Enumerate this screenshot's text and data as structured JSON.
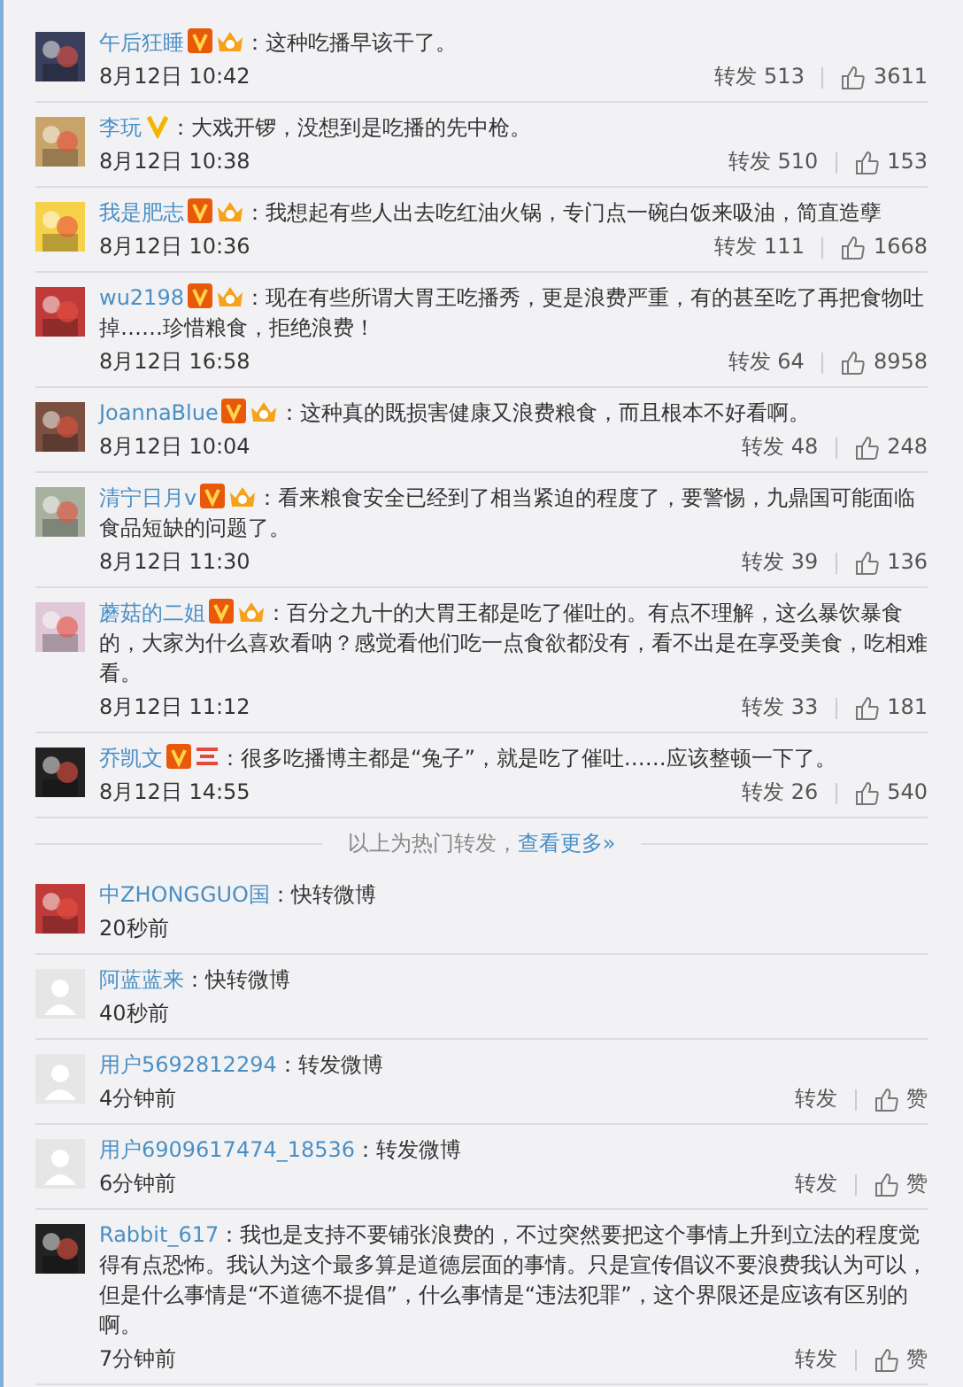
{
  "hot_reposts": [
    {
      "default_avatar": false,
      "name": "午后狂睡",
      "badges": [
        {
          "kind": "verified"
        },
        {
          "kind": "member"
        }
      ],
      "text": "：这种吃播早该干了。",
      "time": "8月12日 10:42",
      "repost": "转发 513",
      "like": "3611"
    },
    {
      "default_avatar": false,
      "name": "李玩",
      "badges": [
        {
          "kind": "personal"
        }
      ],
      "text": "：大戏开锣，没想到是吃播的先中枪。",
      "time": "8月12日 10:38",
      "repost": "转发 510",
      "like": "153"
    },
    {
      "default_avatar": false,
      "name": "我是肥志",
      "badges": [
        {
          "kind": "verified"
        },
        {
          "kind": "member"
        }
      ],
      "text": "：我想起有些人出去吃红油火锅，专门点一碗白饭来吸油，简直造孽",
      "time": "8月12日 10:36",
      "repost": "转发 111",
      "like": "1668"
    },
    {
      "default_avatar": false,
      "name": "wu2198",
      "badges": [
        {
          "kind": "verified"
        },
        {
          "kind": "member"
        }
      ],
      "text": "：现在有些所谓大胃王吃播秀，更是浪费严重，有的甚至吃了再把食物吐掉……珍惜粮食，拒绝浪费！",
      "time": "8月12日 16:58",
      "repost": "转发 64",
      "like": "8958"
    },
    {
      "default_avatar": false,
      "name": "JoannaBlue",
      "badges": [
        {
          "kind": "verified"
        },
        {
          "kind": "member"
        }
      ],
      "text": "：这种真的既损害健康又浪费粮食，而且根本不好看啊。",
      "time": "8月12日 10:04",
      "repost": "转发 48",
      "like": "248"
    },
    {
      "default_avatar": false,
      "name": "清宁日月v",
      "badges": [
        {
          "kind": "verified"
        },
        {
          "kind": "member"
        }
      ],
      "text": "：看来粮食安全已经到了相当紧迫的程度了，要警惕，九鼎国可能面临食品短缺的问题了。",
      "time": "8月12日 11:30",
      "repost": "转发 39",
      "like": "136"
    },
    {
      "default_avatar": false,
      "name": "蘑菇的二姐",
      "badges": [
        {
          "kind": "verified"
        },
        {
          "kind": "member"
        }
      ],
      "text": "：百分之九十的大胃王都是吃了催吐的。有点不理解，这么暴饮暴食的，大家为什么喜欢看呐？感觉看他们吃一点食欲都没有，看不出是在享受美食，吃相难看。",
      "time": "8月12日 11:12",
      "repost": "转发 33",
      "like": "181"
    },
    {
      "default_avatar": false,
      "name": "乔凯文",
      "badges": [
        {
          "kind": "verified"
        },
        {
          "kind": "rank"
        }
      ],
      "text": "：很多吃播博主都是“兔子”，就是吃了催吐……应该整顿一下了。",
      "time": "8月12日 14:55",
      "repost": "转发 26",
      "like": "540"
    }
  ],
  "more_divider": {
    "text": "以上为热门转发，",
    "link": "查看更多»"
  },
  "latest_reposts": [
    {
      "default_avatar": false,
      "name": "中ZHONGGUO国",
      "text": "：快转微博",
      "time": "20秒前"
    },
    {
      "default_avatar": true,
      "name": "阿蓝蓝来",
      "text": "：快转微博",
      "time": "40秒前"
    },
    {
      "default_avatar": true,
      "name": "用户5692812294",
      "text": "：转发微博",
      "time": "4分钟前",
      "repost": "转发",
      "like": "赞"
    },
    {
      "default_avatar": true,
      "name": "用户6909617474_18536",
      "text": "：转发微博",
      "time": "6分钟前",
      "repost": "转发",
      "like": "赞"
    },
    {
      "default_avatar": false,
      "name": "Rabbit_617",
      "text": "：我也是支持不要铺张浪费的，不过突然要把这个事情上升到立法的程度觉得有点恐怖。我认为这个最多算是道德层面的事情。只是宣传倡议不要浪费我认为可以，但是什么事情是“不道德不提倡”，什么事情是“违法犯罪”，这个界限还是应该有区别的啊。",
      "time": "7分钟前",
      "repost": "转发",
      "like": "赞"
    }
  ]
}
